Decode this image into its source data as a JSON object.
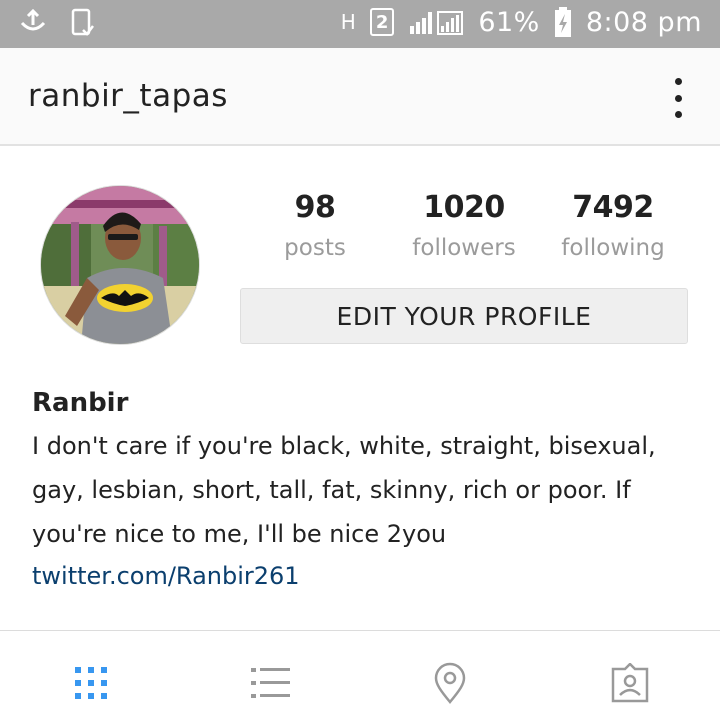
{
  "status_bar": {
    "network_label": "H",
    "sim_label": "2",
    "battery": "61%",
    "time": "8:08 pm",
    "icons": [
      "usb-icon",
      "device-icon",
      "signal-icon",
      "battery-charging-icon"
    ]
  },
  "header": {
    "username": "ranbir_tapas",
    "menu_icon": "more-vertical-icon"
  },
  "profile": {
    "avatar": "profile-photo",
    "stats": [
      {
        "value": "98",
        "label": "posts"
      },
      {
        "value": "1020",
        "label": "followers"
      },
      {
        "value": "7492",
        "label": "following"
      }
    ],
    "edit_button": "EDIT YOUR PROFILE"
  },
  "bio": {
    "name": "Ranbir",
    "text": "I don't care if you're black, white, straight, bisexual, gay, lesbian, short, tall, fat, skinny, rich or poor. If you're nice to me, I'll be nice 2you",
    "link": "twitter.com/Ranbir261"
  },
  "tabs": [
    {
      "icon": "grid-icon",
      "active": true
    },
    {
      "icon": "list-icon",
      "active": false
    },
    {
      "icon": "location-pin-icon",
      "active": false
    },
    {
      "icon": "tagged-photos-icon",
      "active": false
    }
  ],
  "colors": {
    "status_bar": "#a9a9a9",
    "active_tab": "#3897f0",
    "inactive_tab": "#999999",
    "link": "#0b3f6e"
  }
}
